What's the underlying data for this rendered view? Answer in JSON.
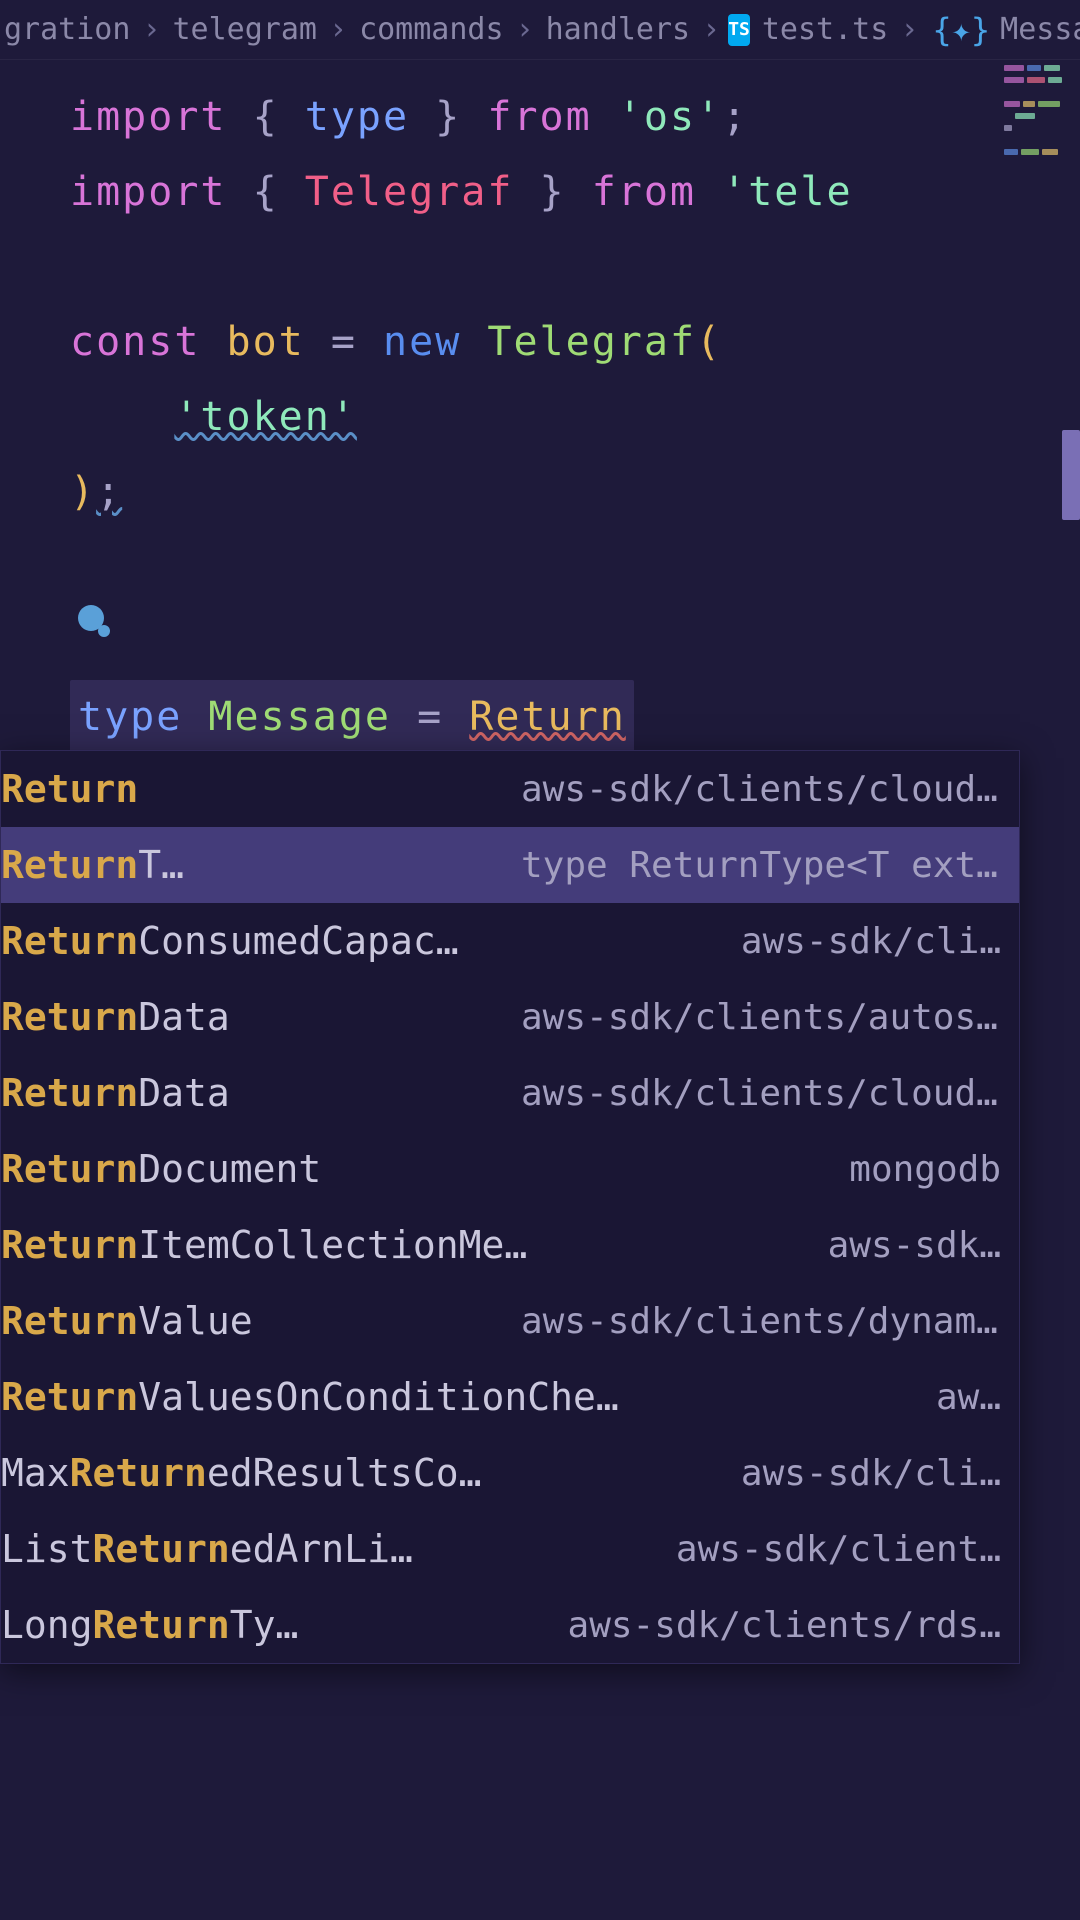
{
  "breadcrumb": {
    "items": [
      "gration",
      "telegram",
      "commands",
      "handlers"
    ],
    "file": "test.ts",
    "symbol": "Message"
  },
  "code": {
    "l1": {
      "import": "import",
      "brace_o": "{ ",
      "type_kw": "type",
      "brace_c": " }",
      "from": "from",
      "str": "'os'",
      "semi": ";"
    },
    "l2": {
      "import": "import",
      "brace_o": "{ ",
      "ident": "Telegraf",
      "brace_c": " }",
      "from": "from",
      "str": "'tele"
    },
    "l4": {
      "const_kw": "const",
      "var": "bot",
      "eq": "=",
      "new_kw": "new",
      "klass": "Telegraf",
      "paren": "("
    },
    "l5": {
      "str": "'token'"
    },
    "l6": {
      "close": ")",
      "semi": ";"
    },
    "l9": {
      "type_kw": "type",
      "name": "Message",
      "eq": "=",
      "val": "Return"
    }
  },
  "autocomplete": {
    "selectedIndex": 1,
    "items": [
      {
        "pre": "",
        "match": "Return",
        "suf": "",
        "detail": "aws-sdk/clients/cloudsear…"
      },
      {
        "pre": "",
        "match": "Return",
        "suf": "T…",
        "detail": "type ReturnType<T extends…"
      },
      {
        "pre": "",
        "match": "Return",
        "suf": "ConsumedCapac…",
        "detail": "aws-sdk/cli…"
      },
      {
        "pre": "",
        "match": "Return",
        "suf": "Data",
        "detail": "aws-sdk/clients/autosca…"
      },
      {
        "pre": "",
        "match": "Return",
        "suf": "Data",
        "detail": "aws-sdk/clients/cloudwa…"
      },
      {
        "pre": "",
        "match": "Return",
        "suf": "Document",
        "detail": "mongodb"
      },
      {
        "pre": "",
        "match": "Return",
        "suf": "ItemCollectionMe…",
        "detail": "aws-sdk…"
      },
      {
        "pre": "",
        "match": "Return",
        "suf": "Value",
        "detail": "aws-sdk/clients/dynamo…"
      },
      {
        "pre": "",
        "match": "Return",
        "suf": "ValuesOnConditionChec…",
        "detail": "aw…"
      },
      {
        "pre": "Max",
        "match": "Return",
        "suf": "edResultsCo…",
        "detail": "aws-sdk/cli…"
      },
      {
        "pre": "List",
        "match": "Return",
        "suf": "edArnLi…",
        "detail": "aws-sdk/client…"
      },
      {
        "pre": "Long",
        "match": "Return",
        "suf": "Ty…",
        "detail": "aws-sdk/clients/rds…"
      }
    ]
  }
}
